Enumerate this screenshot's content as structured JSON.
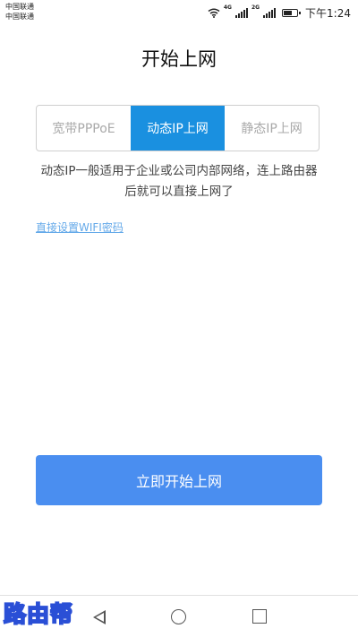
{
  "statusbar": {
    "carrier_1": "中国联通",
    "carrier_2": "中国联通",
    "signal_1_tag": "4G",
    "signal_2_tag": "2G",
    "time": "下午1:24"
  },
  "page_title": "开始上网",
  "tabs": [
    {
      "label": "宽带PPPoE",
      "active": false
    },
    {
      "label": "动态IP上网",
      "active": true
    },
    {
      "label": "静态IP上网",
      "active": false
    }
  ],
  "description": "动态IP一般适用于企业或公司内部网络，连上路由器后就可以直接上网了",
  "wifi_link": "直接设置WIFI密码",
  "start_button": "立即开始上网",
  "watermark": "路由帮",
  "colors": {
    "accent": "#1a90e0",
    "button": "#4a8ef0",
    "link": "#64a9e9"
  }
}
